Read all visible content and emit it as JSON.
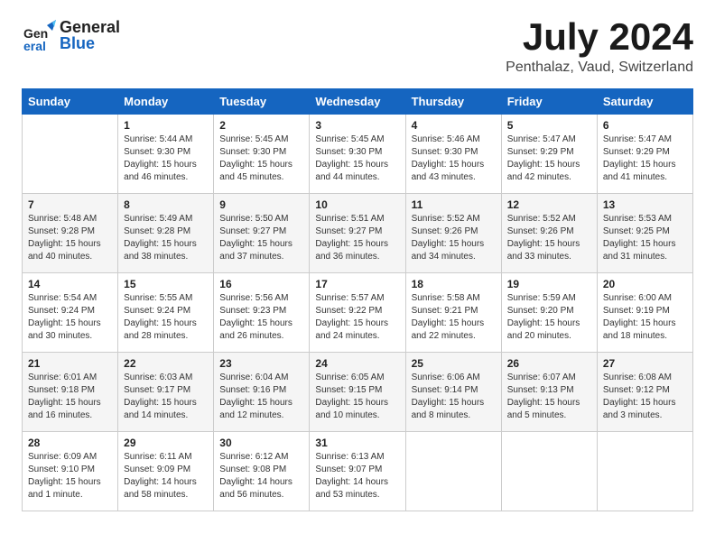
{
  "header": {
    "logo_general": "General",
    "logo_blue": "Blue",
    "month_title": "July 2024",
    "location": "Penthalaz, Vaud, Switzerland"
  },
  "columns": [
    "Sunday",
    "Monday",
    "Tuesday",
    "Wednesday",
    "Thursday",
    "Friday",
    "Saturday"
  ],
  "weeks": [
    [
      {
        "date": "",
        "content": ""
      },
      {
        "date": "1",
        "content": "Sunrise: 5:44 AM\nSunset: 9:30 PM\nDaylight: 15 hours\nand 46 minutes."
      },
      {
        "date": "2",
        "content": "Sunrise: 5:45 AM\nSunset: 9:30 PM\nDaylight: 15 hours\nand 45 minutes."
      },
      {
        "date": "3",
        "content": "Sunrise: 5:45 AM\nSunset: 9:30 PM\nDaylight: 15 hours\nand 44 minutes."
      },
      {
        "date": "4",
        "content": "Sunrise: 5:46 AM\nSunset: 9:30 PM\nDaylight: 15 hours\nand 43 minutes."
      },
      {
        "date": "5",
        "content": "Sunrise: 5:47 AM\nSunset: 9:29 PM\nDaylight: 15 hours\nand 42 minutes."
      },
      {
        "date": "6",
        "content": "Sunrise: 5:47 AM\nSunset: 9:29 PM\nDaylight: 15 hours\nand 41 minutes."
      }
    ],
    [
      {
        "date": "7",
        "content": "Sunrise: 5:48 AM\nSunset: 9:28 PM\nDaylight: 15 hours\nand 40 minutes."
      },
      {
        "date": "8",
        "content": "Sunrise: 5:49 AM\nSunset: 9:28 PM\nDaylight: 15 hours\nand 38 minutes."
      },
      {
        "date": "9",
        "content": "Sunrise: 5:50 AM\nSunset: 9:27 PM\nDaylight: 15 hours\nand 37 minutes."
      },
      {
        "date": "10",
        "content": "Sunrise: 5:51 AM\nSunset: 9:27 PM\nDaylight: 15 hours\nand 36 minutes."
      },
      {
        "date": "11",
        "content": "Sunrise: 5:52 AM\nSunset: 9:26 PM\nDaylight: 15 hours\nand 34 minutes."
      },
      {
        "date": "12",
        "content": "Sunrise: 5:52 AM\nSunset: 9:26 PM\nDaylight: 15 hours\nand 33 minutes."
      },
      {
        "date": "13",
        "content": "Sunrise: 5:53 AM\nSunset: 9:25 PM\nDaylight: 15 hours\nand 31 minutes."
      }
    ],
    [
      {
        "date": "14",
        "content": "Sunrise: 5:54 AM\nSunset: 9:24 PM\nDaylight: 15 hours\nand 30 minutes."
      },
      {
        "date": "15",
        "content": "Sunrise: 5:55 AM\nSunset: 9:24 PM\nDaylight: 15 hours\nand 28 minutes."
      },
      {
        "date": "16",
        "content": "Sunrise: 5:56 AM\nSunset: 9:23 PM\nDaylight: 15 hours\nand 26 minutes."
      },
      {
        "date": "17",
        "content": "Sunrise: 5:57 AM\nSunset: 9:22 PM\nDaylight: 15 hours\nand 24 minutes."
      },
      {
        "date": "18",
        "content": "Sunrise: 5:58 AM\nSunset: 9:21 PM\nDaylight: 15 hours\nand 22 minutes."
      },
      {
        "date": "19",
        "content": "Sunrise: 5:59 AM\nSunset: 9:20 PM\nDaylight: 15 hours\nand 20 minutes."
      },
      {
        "date": "20",
        "content": "Sunrise: 6:00 AM\nSunset: 9:19 PM\nDaylight: 15 hours\nand 18 minutes."
      }
    ],
    [
      {
        "date": "21",
        "content": "Sunrise: 6:01 AM\nSunset: 9:18 PM\nDaylight: 15 hours\nand 16 minutes."
      },
      {
        "date": "22",
        "content": "Sunrise: 6:03 AM\nSunset: 9:17 PM\nDaylight: 15 hours\nand 14 minutes."
      },
      {
        "date": "23",
        "content": "Sunrise: 6:04 AM\nSunset: 9:16 PM\nDaylight: 15 hours\nand 12 minutes."
      },
      {
        "date": "24",
        "content": "Sunrise: 6:05 AM\nSunset: 9:15 PM\nDaylight: 15 hours\nand 10 minutes."
      },
      {
        "date": "25",
        "content": "Sunrise: 6:06 AM\nSunset: 9:14 PM\nDaylight: 15 hours\nand 8 minutes."
      },
      {
        "date": "26",
        "content": "Sunrise: 6:07 AM\nSunset: 9:13 PM\nDaylight: 15 hours\nand 5 minutes."
      },
      {
        "date": "27",
        "content": "Sunrise: 6:08 AM\nSunset: 9:12 PM\nDaylight: 15 hours\nand 3 minutes."
      }
    ],
    [
      {
        "date": "28",
        "content": "Sunrise: 6:09 AM\nSunset: 9:10 PM\nDaylight: 15 hours\nand 1 minute."
      },
      {
        "date": "29",
        "content": "Sunrise: 6:11 AM\nSunset: 9:09 PM\nDaylight: 14 hours\nand 58 minutes."
      },
      {
        "date": "30",
        "content": "Sunrise: 6:12 AM\nSunset: 9:08 PM\nDaylight: 14 hours\nand 56 minutes."
      },
      {
        "date": "31",
        "content": "Sunrise: 6:13 AM\nSunset: 9:07 PM\nDaylight: 14 hours\nand 53 minutes."
      },
      {
        "date": "",
        "content": ""
      },
      {
        "date": "",
        "content": ""
      },
      {
        "date": "",
        "content": ""
      }
    ]
  ]
}
